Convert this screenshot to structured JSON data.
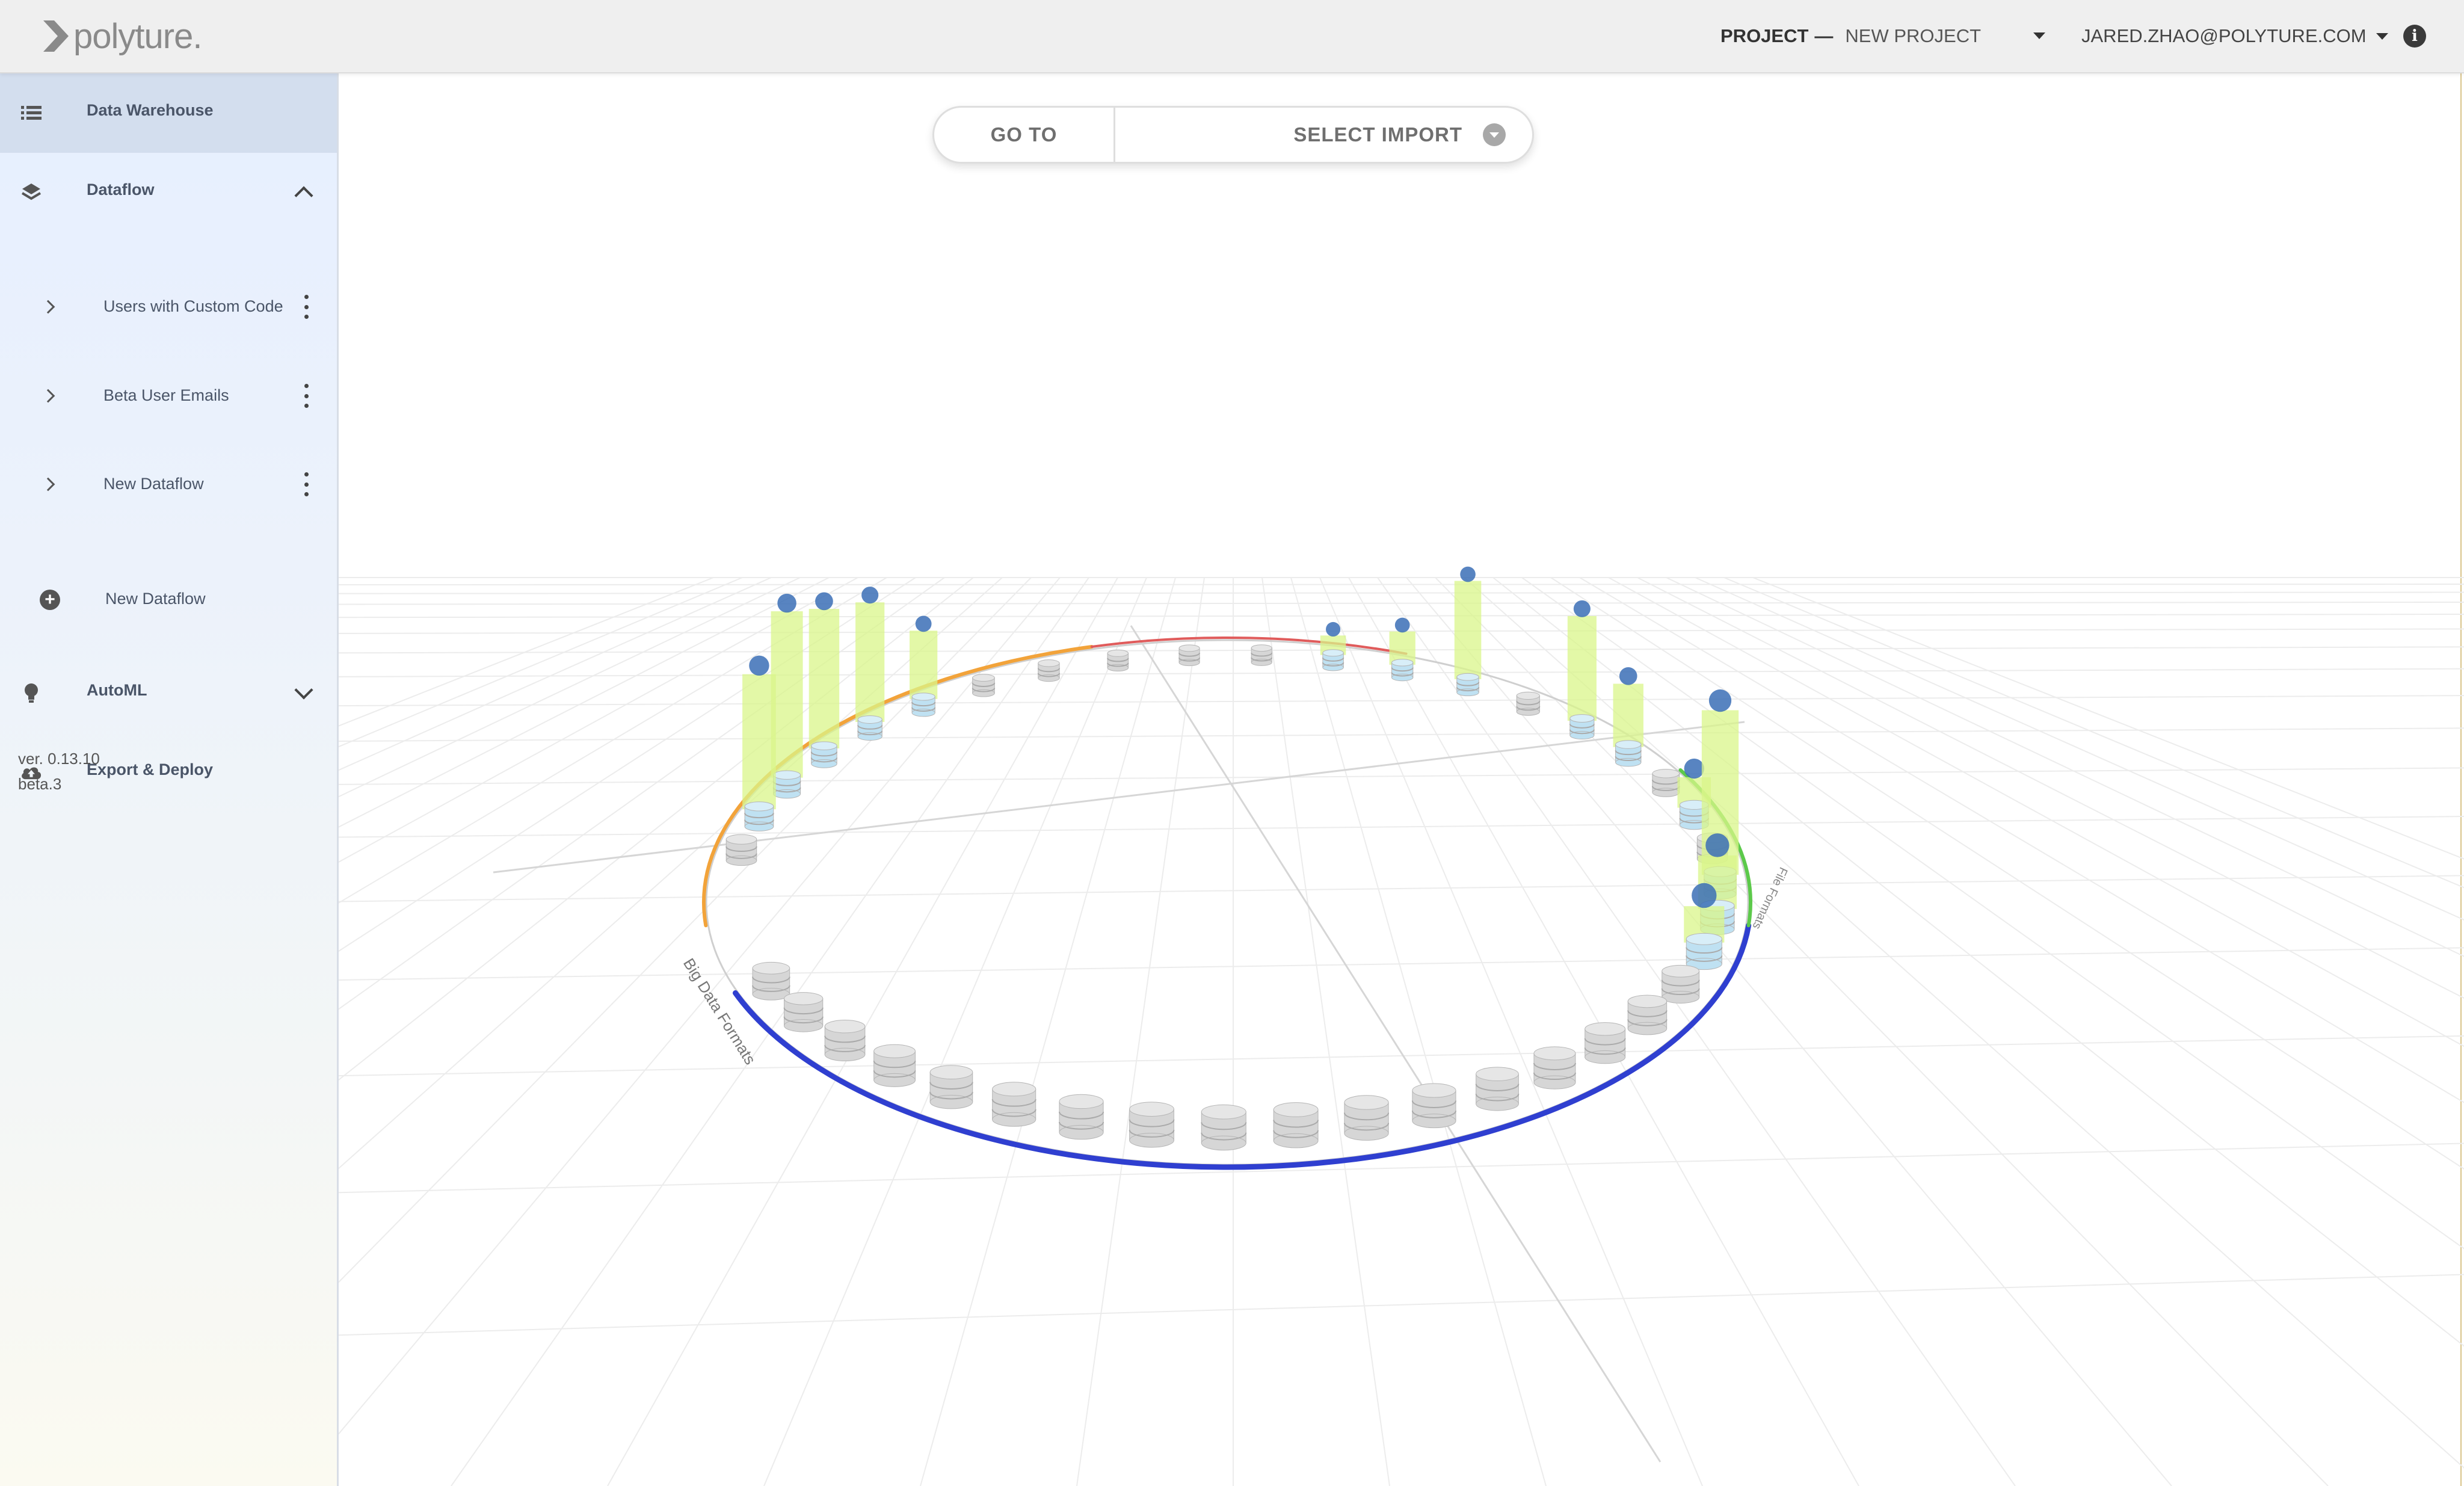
{
  "header": {
    "logo_text": "polyture.",
    "project_label": "PROJECT",
    "project_dash": "—",
    "project_value": "NEW PROJECT",
    "user_email": "JARED.ZHAO@POLYTURE.COM",
    "info_icon": "info-icon"
  },
  "sidebar": {
    "items": [
      {
        "label": "Data Warehouse",
        "icon": "list-icon",
        "active": true
      },
      {
        "label": "Dataflow",
        "icon": "layers-icon",
        "expanded": true
      },
      {
        "label": "AutoML",
        "icon": "lightbulb-icon",
        "expanded": false
      },
      {
        "label": "Export & Deploy",
        "icon": "cloud-upload-icon"
      }
    ],
    "dataflows": [
      {
        "label": "Users with Custom Code"
      },
      {
        "label": "Beta User Emails"
      },
      {
        "label": "New Dataflow"
      }
    ],
    "add_label": "New Dataflow",
    "version_line1": "ver. 0.13.10",
    "version_line2": "beta.3"
  },
  "toolbar": {
    "goto_label": "GO TO",
    "import_label": "SELECT IMPORT"
  },
  "scene": {
    "ring_labels": {
      "blue_arc": "Big Data Formats",
      "green_arc": "File Formats"
    },
    "colors": {
      "orange_arc": "#f2a33a",
      "blue_arc": "#2f3fd0",
      "green_arc": "#5cc94a",
      "red_arc": "#e05b5b",
      "active_column": "#d9f58a",
      "cylinder_active": "#bfe1f2",
      "cylinder_idle": "#d6d6d6"
    }
  }
}
